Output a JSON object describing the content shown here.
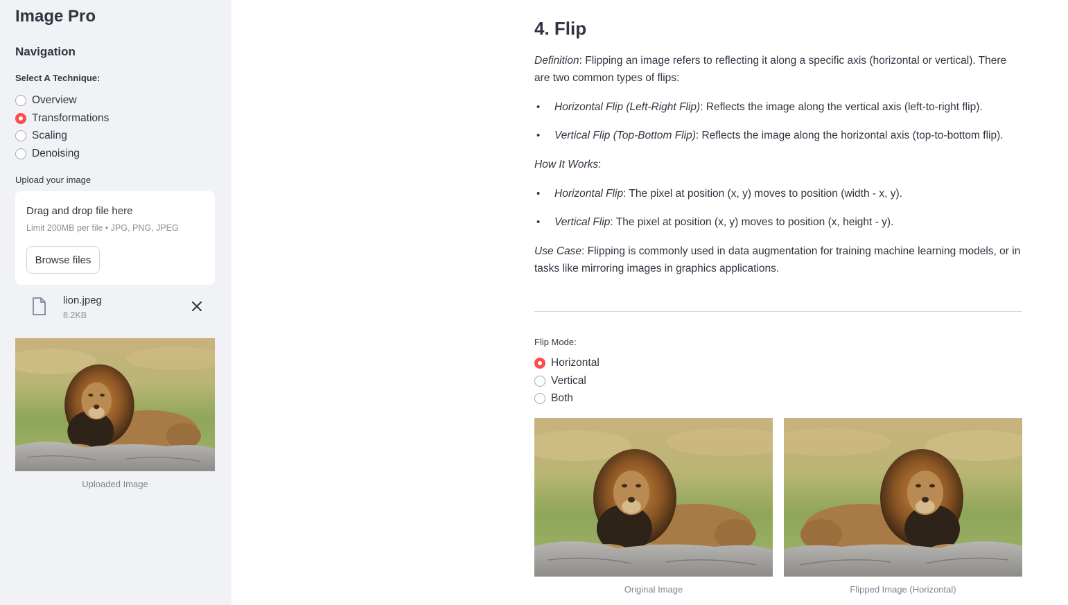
{
  "sidebar": {
    "app_title": "Image Pro",
    "nav_heading": "Navigation",
    "select_label": "Select A Technique:",
    "techniques": [
      {
        "label": "Overview",
        "selected": false
      },
      {
        "label": "Transformations",
        "selected": true
      },
      {
        "label": "Scaling",
        "selected": false
      },
      {
        "label": "Denoising",
        "selected": false
      }
    ],
    "upload_label": "Upload your image",
    "dropzone": {
      "title": "Drag and drop file here",
      "limits": "Limit 200MB per file • JPG, PNG, JPEG",
      "browse_label": "Browse files"
    },
    "file": {
      "name": "lion.jpeg",
      "size": "8.2KB",
      "icon": "file-icon",
      "remove_icon": "close-icon"
    },
    "uploaded_caption": "Uploaded Image"
  },
  "main": {
    "title": "4. Flip",
    "definition_label": "Definition",
    "definition_text": ": Flipping an image refers to reflecting it along a specific axis (horizontal or vertical). There are two common types of flips:",
    "types": [
      {
        "term": "Horizontal Flip (Left-Right Flip)",
        "text": ": Reflects the image along the vertical axis (left-to-right flip)."
      },
      {
        "term": "Vertical Flip (Top-Bottom Flip)",
        "text": ": Reflects the image along the horizontal axis (top-to-bottom flip)."
      }
    ],
    "how_label": "How It Works",
    "how_suffix": ":",
    "how_items": [
      {
        "term": "Horizontal Flip",
        "text": ": The pixel at position (x, y) moves to position (width - x, y)."
      },
      {
        "term": "Vertical Flip",
        "text": ": The pixel at position (x, y) moves to position (x, height - y)."
      }
    ],
    "usecase_label": "Use Case",
    "usecase_text": ": Flipping is commonly used in data augmentation for training machine learning models, or in tasks like mirroring images in graphics applications.",
    "flip_mode_label": "Flip Mode:",
    "flip_modes": [
      {
        "label": "Horizontal",
        "selected": true
      },
      {
        "label": "Vertical",
        "selected": false
      },
      {
        "label": "Both",
        "selected": false
      }
    ],
    "original_caption": "Original Image",
    "flipped_caption": "Flipped Image (Horizontal)"
  },
  "colors": {
    "accent": "#ff4b4b",
    "sidebar_bg": "#f0f2f6",
    "text": "#31333f",
    "muted": "#8b8f9a"
  }
}
